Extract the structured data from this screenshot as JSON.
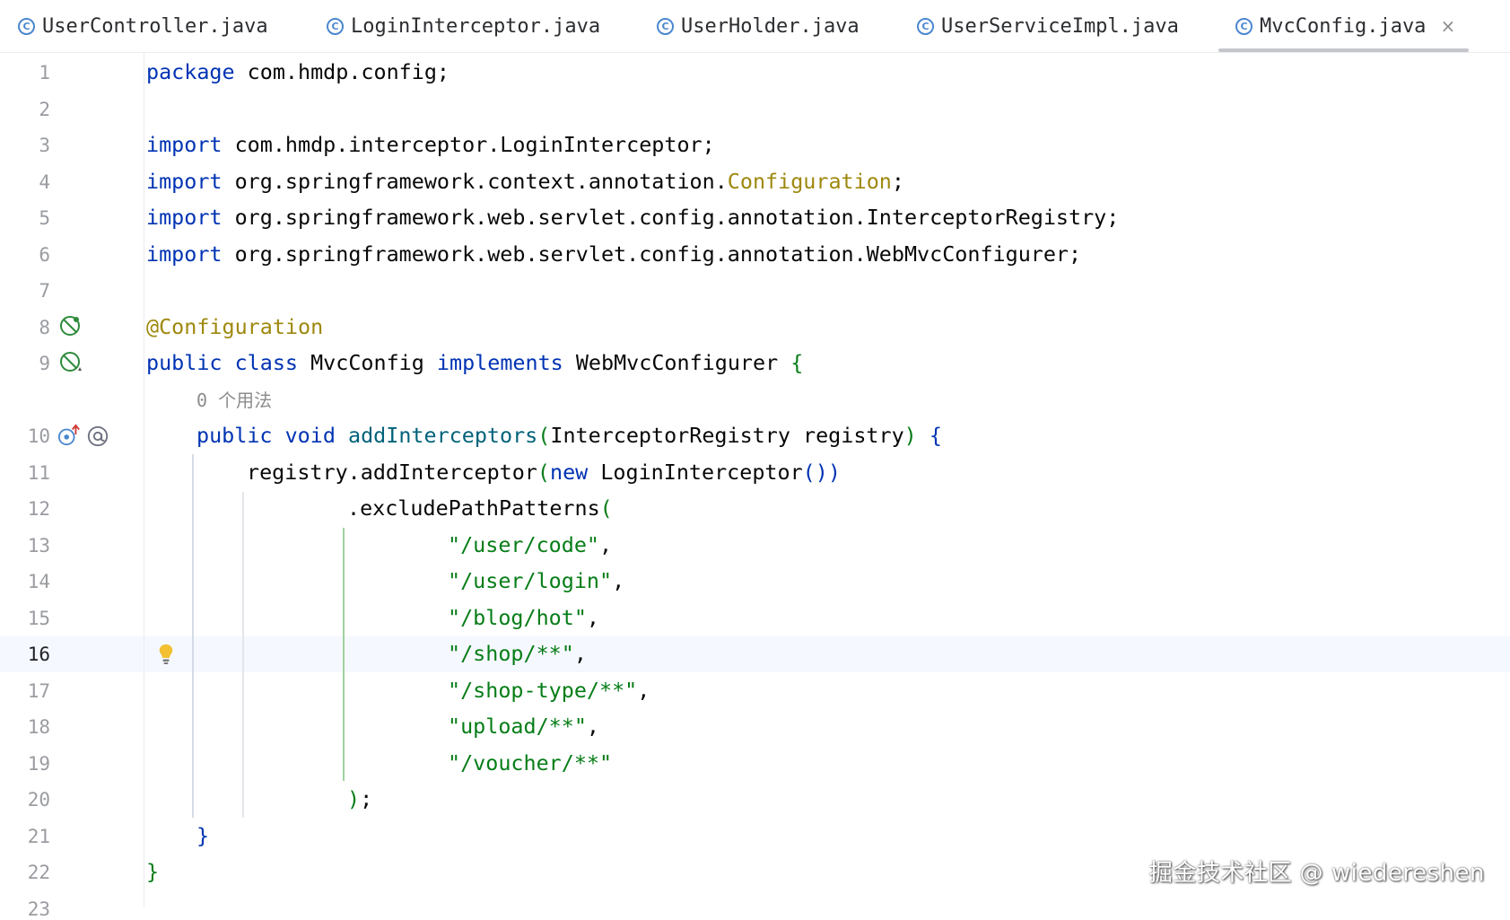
{
  "tabs": [
    {
      "label": "UserController.java",
      "active": false
    },
    {
      "label": "LoginInterceptor.java",
      "active": false
    },
    {
      "label": "UserHolder.java",
      "active": false
    },
    {
      "label": "UserServiceImpl.java",
      "active": false
    },
    {
      "label": "MvcConfig.java",
      "active": true
    }
  ],
  "editor": {
    "current_line": "16",
    "usage_hint": "0 个用法",
    "line_numbers": [
      "1",
      "2",
      "3",
      "4",
      "5",
      "6",
      "7",
      "8",
      "9",
      "10",
      "11",
      "12",
      "13",
      "14",
      "15",
      "16",
      "17",
      "18",
      "19",
      "20",
      "21",
      "22",
      "23"
    ],
    "lines": {
      "l1": {
        "kw": "package",
        "rest": " com.hmdp.config;"
      },
      "l3": {
        "kw": "import",
        "rest": " com.hmdp.interceptor.LoginInterceptor;"
      },
      "l4": {
        "kw": "import",
        "rest": " org.springframework.context.annotation.",
        "ann": "Configuration",
        "tail": ";"
      },
      "l5": {
        "kw": "import",
        "rest": " org.springframework.web.servlet.config.annotation.InterceptorRegistry;"
      },
      "l6": {
        "kw": "import",
        "rest": " org.springframework.web.servlet.config.annotation.WebMvcConfigurer;"
      },
      "l8": {
        "ann": "@Configuration"
      },
      "l9": {
        "kw1": "public",
        "kw2": "class",
        "name": " MvcConfig ",
        "kw3": "implements",
        "rest": " WebMvcConfigurer ",
        "brace": "{"
      },
      "l10": {
        "kw1": "public",
        "kw2": "void",
        "method": " addInterceptors",
        "p1": "(",
        "params": "InterceptorRegistry registry",
        "p2": ")",
        "brace": " {"
      },
      "l11": {
        "pre": "registry.addInterceptor",
        "p1": "(",
        "kw": "new",
        "rest": " LoginInterceptor",
        "p2": "())"
      },
      "l12": {
        "pre": ".excludePathPatterns",
        "p1": "("
      },
      "l13": {
        "str": "\"/user/code\"",
        "tail": ","
      },
      "l14": {
        "str": "\"/user/login\"",
        "tail": ","
      },
      "l15": {
        "str": "\"/blog/hot\"",
        "tail": ","
      },
      "l16": {
        "str": "\"/shop/**\"",
        "tail": ","
      },
      "l17": {
        "str": "\"/shop-type/**\"",
        "tail": ","
      },
      "l18": {
        "str": "\"upload/**\"",
        "tail": ","
      },
      "l19": {
        "str": "\"/voucher/**\""
      },
      "l20": {
        "p": ")",
        "tail": ";"
      },
      "l21": {
        "brace": "}"
      },
      "l22": {
        "brace": "}"
      }
    }
  },
  "icons": {
    "tab_file": "java-class-icon",
    "tab_close": "close-icon",
    "gutter_l8": "bean-config-icon",
    "gutter_l9": "bean-config-icon",
    "gutter_l10_a": "implements-method-icon",
    "gutter_l10_b": "at-annotation-icon",
    "gutter_l16": "lightbulb-icon"
  },
  "colors": {
    "keyword": "#0033b3",
    "annotation": "#9e880d",
    "string": "#067d17",
    "text": "#080808",
    "line_number": "#9a9ca1",
    "current_line_bg": "#f5f8fe",
    "class_icon": "#4a87cf",
    "bean_icon": "#2e8b3c",
    "bulb": "#f2c031"
  },
  "watermark": "掘金技术社区 @ wiedereshen"
}
